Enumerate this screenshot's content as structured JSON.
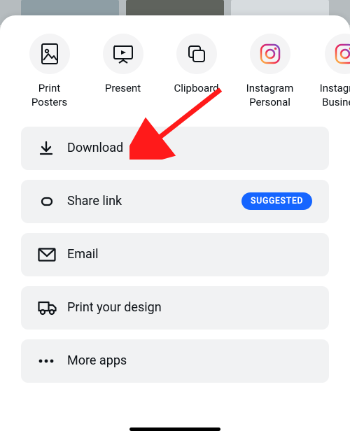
{
  "destinations": [
    {
      "name": "print-posters",
      "label": "Print Posters"
    },
    {
      "name": "present",
      "label": "Present"
    },
    {
      "name": "clipboard",
      "label": "Clipboard"
    },
    {
      "name": "instagram-personal",
      "label": "Instagram Personal"
    },
    {
      "name": "instagram-business",
      "label": "Instagram Business"
    }
  ],
  "actions": {
    "download": {
      "label": "Download"
    },
    "share_link": {
      "label": "Share link",
      "badge": "SUGGESTED"
    },
    "email": {
      "label": "Email"
    },
    "print_design": {
      "label": "Print your design"
    },
    "more_apps": {
      "label": "More apps"
    }
  }
}
